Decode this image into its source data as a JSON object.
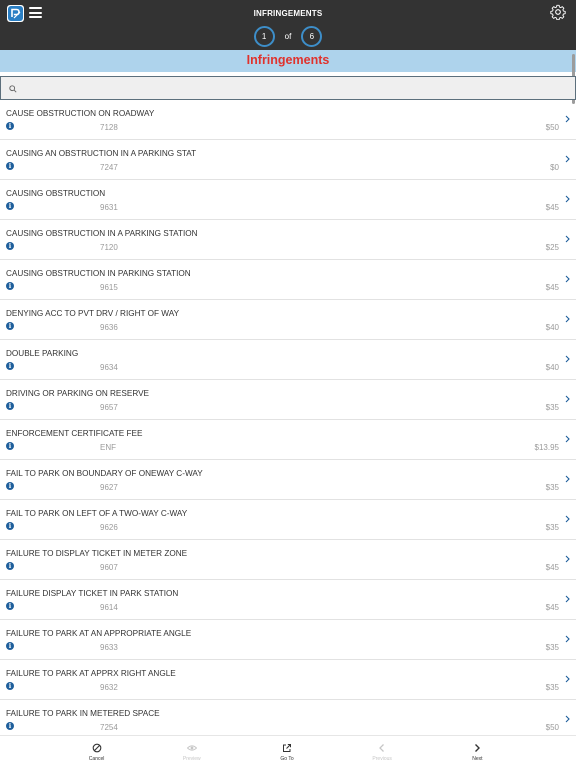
{
  "header": {
    "title": "INFRINGEMENTS",
    "pager": {
      "current": "1",
      "of_label": "of",
      "total": "6"
    }
  },
  "section": {
    "title": "Infringements"
  },
  "search": {
    "placeholder": ""
  },
  "colors": {
    "topbar": "#333333",
    "accent": "#3d8ec9",
    "section_bg": "#aed3ec",
    "section_text": "#e0322d",
    "info_icon": "#1f5f9c"
  },
  "icons": [
    "app-logo-icon",
    "menu-icon",
    "settings-icon",
    "search-icon",
    "info-icon",
    "chevron-right-icon",
    "cancel-icon",
    "eye-icon",
    "go-to-icon",
    "previous-icon",
    "next-icon"
  ],
  "items": [
    {
      "title": "CAUSE OBSTRUCTION ON ROADWAY",
      "code": "7128",
      "amount": "$50"
    },
    {
      "title": "CAUSING AN OBSTRUCTION IN A PARKING STAT",
      "code": "7247",
      "amount": "$0"
    },
    {
      "title": "CAUSING OBSTRUCTION",
      "code": "9631",
      "amount": "$45"
    },
    {
      "title": "CAUSING OBSTRUCTION IN A PARKING STATION",
      "code": "7120",
      "amount": "$25"
    },
    {
      "title": "CAUSING OBSTRUCTION IN PARKING STATION",
      "code": "9615",
      "amount": "$45"
    },
    {
      "title": "DENYING ACC TO PVT  DRV / RIGHT OF WAY",
      "code": "9636",
      "amount": "$40"
    },
    {
      "title": "DOUBLE PARKING",
      "code": "9634",
      "amount": "$40"
    },
    {
      "title": "DRIVING OR PARKING ON RESERVE",
      "code": "9657",
      "amount": "$35"
    },
    {
      "title": "ENFORCEMENT CERTIFICATE FEE",
      "code": "ENF",
      "amount": "$13.95"
    },
    {
      "title": "FAIL TO PARK ON BOUNDARY OF ONEWAY C-WAY",
      "code": "9627",
      "amount": "$35"
    },
    {
      "title": "FAIL TO PARK ON LEFT OF A TWO-WAY C-WAY",
      "code": "9626",
      "amount": "$35"
    },
    {
      "title": "FAILURE TO DISPLAY TICKET IN METER  ZONE",
      "code": "9607",
      "amount": "$45"
    },
    {
      "title": "FAILURE DISPLAY TICKET IN PARK STATION",
      "code": "9614",
      "amount": "$45"
    },
    {
      "title": "FAILURE TO PARK AT AN APPROPRIATE ANGLE",
      "code": "9633",
      "amount": "$35"
    },
    {
      "title": "FAILURE TO PARK AT APPRX  RIGHT ANGLE",
      "code": "9632",
      "amount": "$35"
    },
    {
      "title": "FAILURE TO PARK IN METERED SPACE",
      "code": "7254",
      "amount": "$50"
    }
  ],
  "bottom_bar": {
    "cancel": "Cancel",
    "view": "Preview",
    "goto": "Go To",
    "previous": "Previous",
    "next": "Next"
  }
}
